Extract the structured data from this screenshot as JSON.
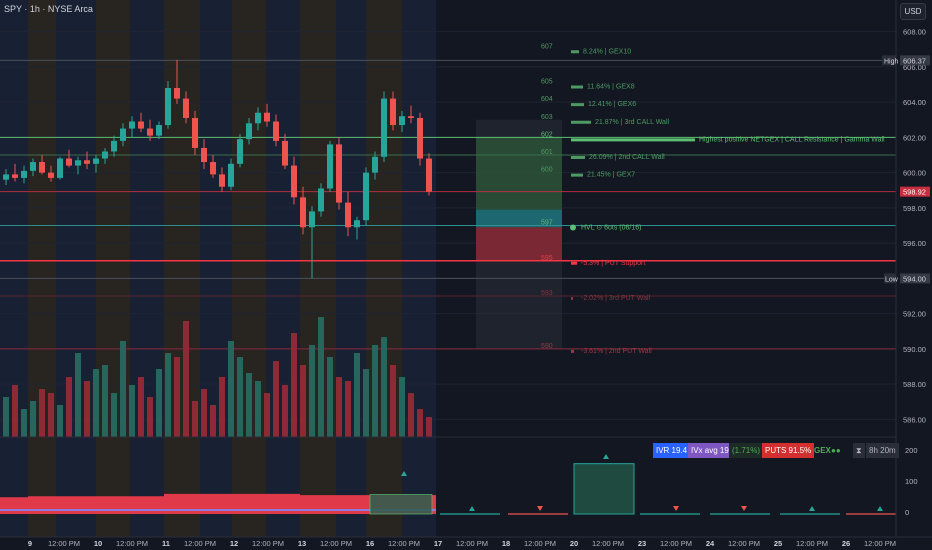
{
  "header": {
    "title": "SPY · 1h · NYSE Arca",
    "currency": "USD"
  },
  "price_scale": {
    "ticks": [
      "608.00",
      "606.00",
      "604.00",
      "602.00",
      "600.00",
      "598.00",
      "596.00",
      "594.00",
      "592.00",
      "590.00",
      "588.00",
      "586.00"
    ],
    "high_label": "High",
    "high_value": "606.37",
    "low_label": "Low",
    "low_value": "594.00",
    "last_value": "598.92"
  },
  "lower_scale": {
    "ticks": [
      "200",
      "100",
      "0"
    ]
  },
  "x_axis": {
    "labels": [
      "9",
      "12:00 PM",
      "10",
      "12:00 PM",
      "11",
      "12:00 PM",
      "12",
      "12:00 PM",
      "13",
      "12:00 PM",
      "16",
      "12:00 PM",
      "17",
      "12:00 PM",
      "18",
      "12:00 PM",
      "20",
      "12:00 PM",
      "23",
      "12:00 PM",
      "24",
      "12:00 PM",
      "25",
      "12:00 PM",
      "26",
      "12:00 PM"
    ]
  },
  "levels": [
    {
      "strike": "607",
      "label": "8.24% | GEX10",
      "color": "#4f9a62"
    },
    {
      "strike": "605",
      "label": "11.64% | GEX8",
      "color": "#4f9a62"
    },
    {
      "strike": "604",
      "label": "12.41% | GEX6",
      "color": "#4f9a62"
    },
    {
      "strike": "603",
      "label": "21.87% | 3rd CALL Wall",
      "color": "#4f9a62"
    },
    {
      "strike": "602",
      "label": "Highest positive NETGEX | CALL Resistance | Gamma Wall",
      "color": "#5cbf72"
    },
    {
      "strike": "601",
      "label": "26.09% | 2nd CALL Wall",
      "color": "#4f9a62"
    },
    {
      "strike": "600",
      "label": "21.45% | GEX7",
      "color": "#4f9a62"
    },
    {
      "strike": "597",
      "label": "HVL ⊙ 6ots (06/16)",
      "color": "#5cbf72"
    },
    {
      "strike": "595",
      "label": "-5.3% | PUT Support",
      "color": "#f23645"
    },
    {
      "strike": "593",
      "label": "-2.02% | 3rd PUT Wall",
      "color": "#8a3340"
    },
    {
      "strike": "590",
      "label": "-3.61% | 2nd PUT Wall",
      "color": "#a33344"
    }
  ],
  "info_chips": {
    "ivr": "IVR 19.4",
    "ivx": "IVx avg 19",
    "change": "(1.71%)",
    "puts": "PUTS 91.5%",
    "gex": "GEX",
    "timer": "8h 20m"
  },
  "chart_data": {
    "type": "candlestick",
    "symbol": "SPY",
    "interval": "1h",
    "exchange": "NYSE Arca",
    "ylim": [
      585,
      609
    ],
    "session_high": 606.37,
    "session_low": 594.0,
    "last": 598.92,
    "candles": [
      {
        "o": 599.6,
        "h": 600.2,
        "l": 599.3,
        "c": 599.9
      },
      {
        "o": 599.9,
        "h": 600.5,
        "l": 599.5,
        "c": 599.7
      },
      {
        "o": 599.7,
        "h": 600.4,
        "l": 599.4,
        "c": 600.1
      },
      {
        "o": 600.1,
        "h": 600.8,
        "l": 599.8,
        "c": 600.6
      },
      {
        "o": 600.6,
        "h": 601.0,
        "l": 599.9,
        "c": 600.0
      },
      {
        "o": 600.0,
        "h": 600.4,
        "l": 599.5,
        "c": 599.7
      },
      {
        "o": 599.7,
        "h": 600.9,
        "l": 599.6,
        "c": 600.8
      },
      {
        "o": 600.8,
        "h": 601.3,
        "l": 600.3,
        "c": 600.4
      },
      {
        "o": 600.4,
        "h": 600.9,
        "l": 599.9,
        "c": 600.7
      },
      {
        "o": 600.7,
        "h": 601.2,
        "l": 600.2,
        "c": 600.5
      },
      {
        "o": 600.5,
        "h": 601.0,
        "l": 600.0,
        "c": 600.8
      },
      {
        "o": 600.8,
        "h": 601.4,
        "l": 600.5,
        "c": 601.2
      },
      {
        "o": 601.2,
        "h": 602.1,
        "l": 600.9,
        "c": 601.8
      },
      {
        "o": 601.8,
        "h": 602.8,
        "l": 601.5,
        "c": 602.5
      },
      {
        "o": 602.5,
        "h": 603.2,
        "l": 602.0,
        "c": 602.9
      },
      {
        "o": 602.9,
        "h": 603.4,
        "l": 602.3,
        "c": 602.5
      },
      {
        "o": 602.5,
        "h": 603.0,
        "l": 601.8,
        "c": 602.1
      },
      {
        "o": 602.1,
        "h": 602.9,
        "l": 601.9,
        "c": 602.7
      },
      {
        "o": 602.7,
        "h": 605.2,
        "l": 602.5,
        "c": 604.8
      },
      {
        "o": 604.8,
        "h": 606.4,
        "l": 603.9,
        "c": 604.2
      },
      {
        "o": 604.2,
        "h": 604.6,
        "l": 602.8,
        "c": 603.1
      },
      {
        "o": 603.1,
        "h": 603.5,
        "l": 601.0,
        "c": 601.4
      },
      {
        "o": 601.4,
        "h": 601.9,
        "l": 600.2,
        "c": 600.6
      },
      {
        "o": 600.6,
        "h": 601.0,
        "l": 599.7,
        "c": 599.9
      },
      {
        "o": 599.9,
        "h": 600.3,
        "l": 598.9,
        "c": 599.2
      },
      {
        "o": 599.2,
        "h": 600.8,
        "l": 599.0,
        "c": 600.5
      },
      {
        "o": 600.5,
        "h": 602.2,
        "l": 600.3,
        "c": 601.9
      },
      {
        "o": 601.9,
        "h": 603.1,
        "l": 601.6,
        "c": 602.8
      },
      {
        "o": 602.8,
        "h": 603.7,
        "l": 602.4,
        "c": 603.4
      },
      {
        "o": 603.4,
        "h": 603.9,
        "l": 602.6,
        "c": 602.9
      },
      {
        "o": 602.9,
        "h": 603.3,
        "l": 601.5,
        "c": 601.8
      },
      {
        "o": 601.8,
        "h": 602.2,
        "l": 600.2,
        "c": 600.4
      },
      {
        "o": 600.4,
        "h": 600.9,
        "l": 598.2,
        "c": 598.6
      },
      {
        "o": 598.6,
        "h": 599.2,
        "l": 596.5,
        "c": 596.9
      },
      {
        "o": 596.9,
        "h": 598.1,
        "l": 594.0,
        "c": 597.8
      },
      {
        "o": 597.8,
        "h": 599.4,
        "l": 597.5,
        "c": 599.1
      },
      {
        "o": 599.1,
        "h": 601.8,
        "l": 598.9,
        "c": 601.6
      },
      {
        "o": 601.6,
        "h": 602.0,
        "l": 597.9,
        "c": 598.3
      },
      {
        "o": 598.3,
        "h": 598.9,
        "l": 596.4,
        "c": 596.9
      },
      {
        "o": 596.9,
        "h": 597.5,
        "l": 596.2,
        "c": 597.3
      },
      {
        "o": 597.3,
        "h": 600.3,
        "l": 597.0,
        "c": 600.0
      },
      {
        "o": 600.0,
        "h": 601.2,
        "l": 599.6,
        "c": 600.9
      },
      {
        "o": 600.9,
        "h": 604.6,
        "l": 600.6,
        "c": 604.2
      },
      {
        "o": 604.2,
        "h": 604.6,
        "l": 602.4,
        "c": 602.7
      },
      {
        "o": 602.7,
        "h": 603.5,
        "l": 602.3,
        "c": 603.2
      },
      {
        "o": 603.2,
        "h": 603.8,
        "l": 602.8,
        "c": 603.1
      },
      {
        "o": 603.1,
        "h": 603.4,
        "l": 600.4,
        "c": 600.8
      },
      {
        "o": 600.8,
        "h": 601.1,
        "l": 598.7,
        "c": 598.92
      }
    ],
    "volume": [
      20,
      26,
      14,
      18,
      24,
      22,
      16,
      30,
      42,
      28,
      34,
      36,
      22,
      48,
      26,
      30,
      20,
      34,
      42,
      40,
      58,
      18,
      24,
      16,
      30,
      48,
      40,
      32,
      28,
      22,
      38,
      26,
      52,
      36,
      46,
      60,
      40,
      30,
      28,
      42,
      34,
      46,
      50,
      36,
      30,
      22,
      14,
      10
    ],
    "gex_indicator": {
      "ticks": [
        200,
        100,
        0
      ],
      "red_area": 64,
      "bar_value": 165
    }
  }
}
